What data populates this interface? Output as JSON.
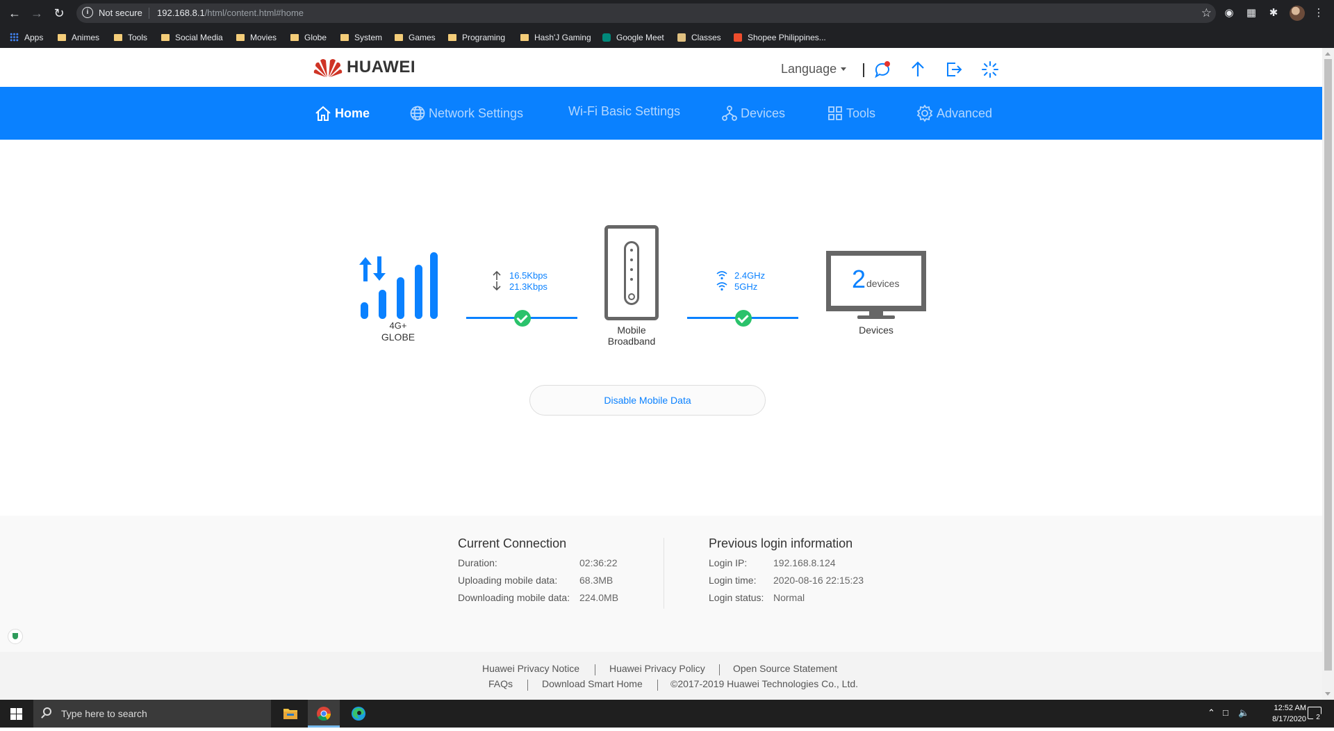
{
  "browser": {
    "security_label": "Not secure",
    "url_host": "192.168.8.1",
    "url_path": "/html/content.html#home",
    "bookmarks": [
      {
        "label": "Apps"
      },
      {
        "label": "Animes"
      },
      {
        "label": "Tools"
      },
      {
        "label": "Social Media"
      },
      {
        "label": "Movies"
      },
      {
        "label": "Globe"
      },
      {
        "label": "System"
      },
      {
        "label": "Games"
      },
      {
        "label": "Programing"
      },
      {
        "label": "Hash'J Gaming"
      },
      {
        "label": "Google Meet"
      },
      {
        "label": "Classes"
      },
      {
        "label": "Shopee Philippines..."
      }
    ]
  },
  "header": {
    "brand": "HUAWEI",
    "language_label": "Language"
  },
  "nav": {
    "items": [
      {
        "label": "Home",
        "active": true
      },
      {
        "label": "Network Settings"
      },
      {
        "label": "Wi-Fi Basic Settings"
      },
      {
        "label": "Devices"
      },
      {
        "label": "Tools"
      },
      {
        "label": "Advanced"
      }
    ]
  },
  "status": {
    "network_type": "4G+",
    "operator": "GLOBE",
    "upload_rate": "16.5Kbps",
    "download_rate": "21.3Kbps",
    "router_label_line1": "Mobile",
    "router_label_line2": "Broadband",
    "wifi_band_1": "2.4GHz",
    "wifi_band_2": "5GHz",
    "device_count": "2",
    "device_count_unit": "devices",
    "devices_label": "Devices",
    "signal_bars_filled": 5,
    "signal_bars_total": 5
  },
  "actions": {
    "disable_mobile_data": "Disable Mobile Data"
  },
  "current_connection": {
    "title": "Current Connection",
    "rows": [
      {
        "label": "Duration:",
        "value": "02:36:22"
      },
      {
        "label": "Uploading mobile data:",
        "value": "68.3MB"
      },
      {
        "label": "Downloading mobile data:",
        "value": "224.0MB"
      }
    ]
  },
  "previous_login": {
    "title": "Previous login information",
    "rows": [
      {
        "label": "Login IP:",
        "value": "192.168.8.124"
      },
      {
        "label": "Login time:",
        "value": "2020-08-16 22:15:23"
      },
      {
        "label": "Login status:",
        "value": "Normal"
      }
    ]
  },
  "footer": {
    "links": [
      "Huawei Privacy Notice",
      "Huawei Privacy Policy",
      "Open Source Statement",
      "FAQs",
      "Download Smart Home"
    ],
    "copyright": "©2017-2019 Huawei Technologies Co., Ltd."
  },
  "taskbar": {
    "search_placeholder": "Type here to search",
    "time": "12:52 AM",
    "date": "8/17/2020",
    "notification_count": "2"
  },
  "colors": {
    "brand_blue": "#0a81ff",
    "ok_green": "#2ac26b",
    "huawei_red": "#cf3426"
  }
}
